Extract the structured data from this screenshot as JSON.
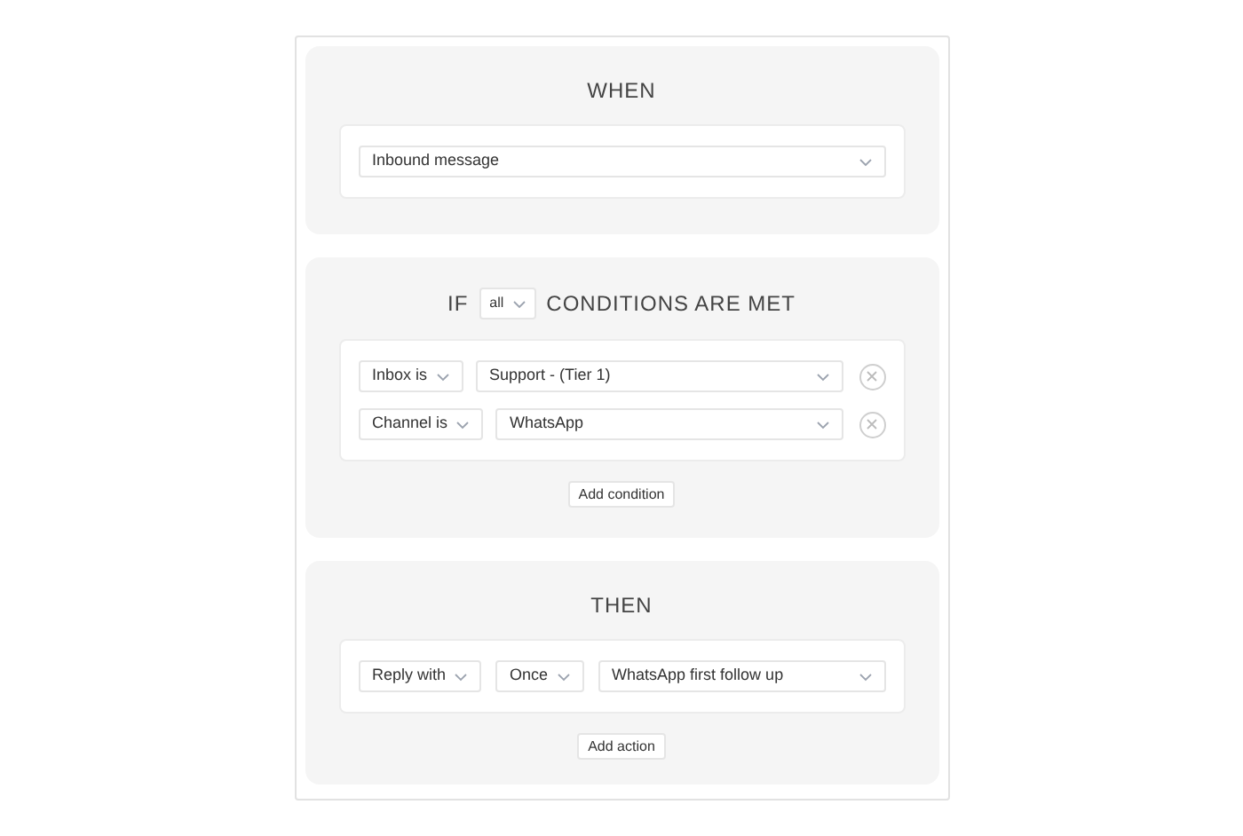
{
  "when": {
    "title": "WHEN",
    "trigger": "Inbound message"
  },
  "if": {
    "title_start": "IF",
    "match": "all",
    "title_end": "CONDITIONS ARE MET",
    "add_button": "Add condition",
    "conditions": [
      {
        "field": "Inbox is",
        "value": "Support - (Tier 1)"
      },
      {
        "field": "Channel is",
        "value": "WhatsApp"
      }
    ]
  },
  "then": {
    "title": "THEN",
    "add_button": "Add action",
    "actions": [
      {
        "action": "Reply with",
        "frequency": "Once",
        "template": "WhatsApp first follow up"
      }
    ]
  }
}
